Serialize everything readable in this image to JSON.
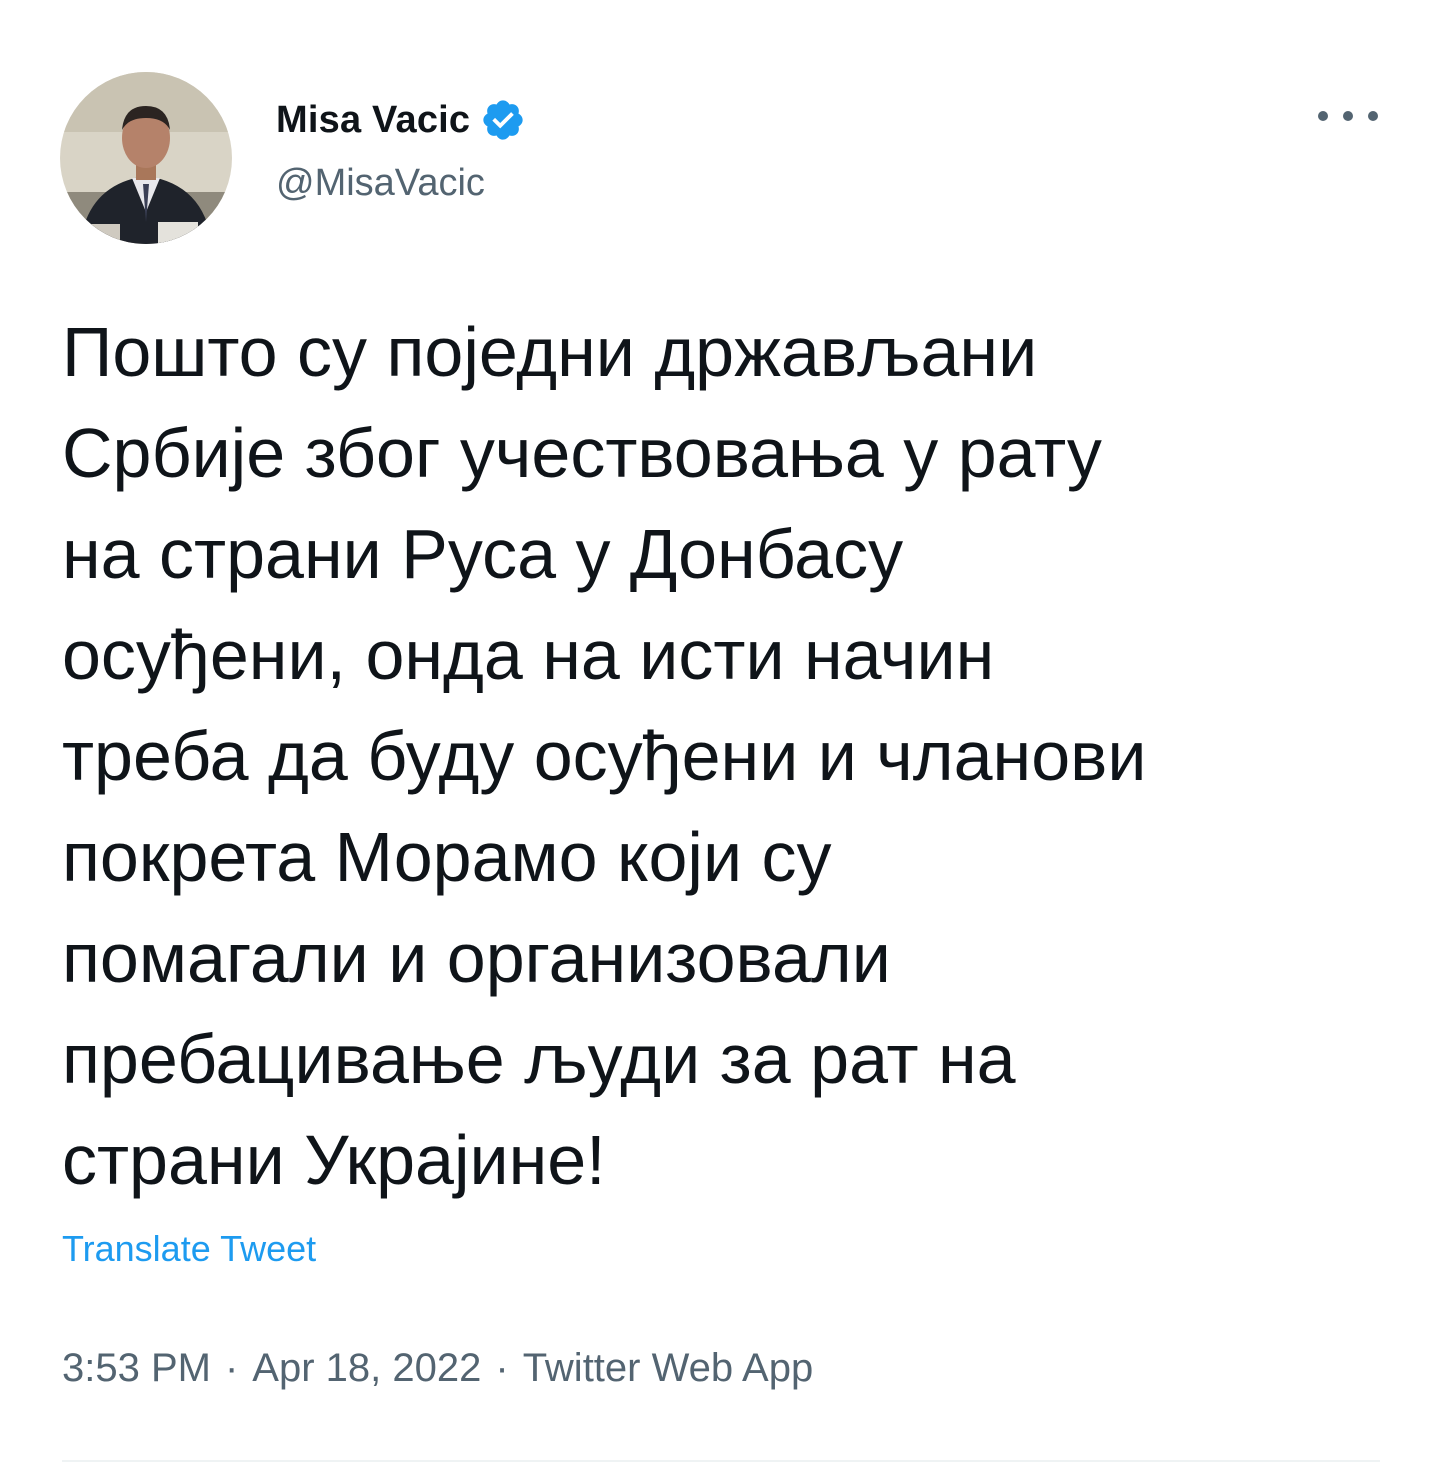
{
  "author": {
    "display_name": "Misa Vacic",
    "handle": "@MisaVacic",
    "verified": true
  },
  "tweet": {
    "text": "Пошто су поједни држављани\nСрбије због учествовања у рату\nна страни Руса у Донбасу\nосуђени, онда на исти начин\nтреба да буду осуђени и чланови\nпокрета Морамо који су\nпомагали и организовали\nпребацивање људи за рат на\nстрани Украјине!",
    "translate_label": "Translate Tweet",
    "time": "3:53 PM",
    "date": "Apr 18, 2022",
    "source": "Twitter Web App",
    "separator": "·"
  },
  "icons": {
    "verified": "verified-badge-icon",
    "more": "more-horizontal-icon"
  },
  "colors": {
    "text": "#0f1419",
    "secondary": "#536471",
    "accent": "#1d9bf0",
    "divider": "#eff3f4"
  }
}
